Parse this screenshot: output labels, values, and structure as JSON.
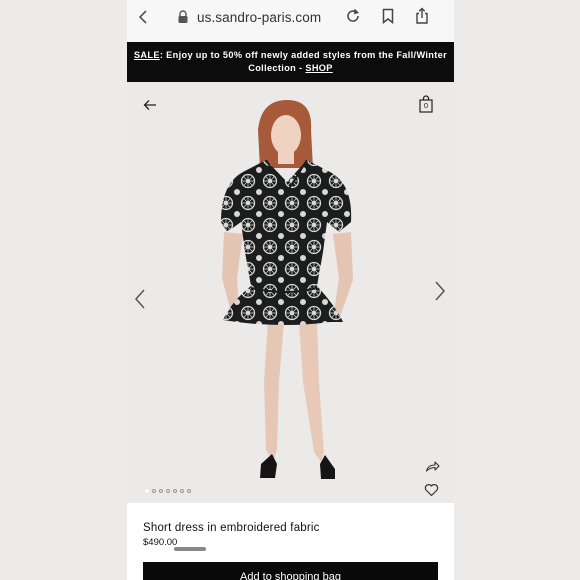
{
  "browser": {
    "url": "us.sandro-paris.com"
  },
  "promo": {
    "sale_label": "SALE",
    "message": ": Enjoy up to 50% off newly added styles from the Fall/Winter Collection - ",
    "shop_label": "SHOP"
  },
  "gallery": {
    "bag_count": "0",
    "image_count": 7,
    "active_index": 0
  },
  "product": {
    "name": "Short dress in embroidered fabric",
    "price": "$490.00",
    "add_to_bag_label": "Add to shopping bag"
  },
  "icons": [
    "chevron-left-icon",
    "lock-icon",
    "reload-icon",
    "bookmark-icon",
    "share-icon",
    "arrow-left-icon",
    "shopping-bag-icon",
    "chevron-right-icon",
    "forward-share-icon",
    "heart-icon"
  ],
  "colors": {
    "banner_background": "#0c0c0c",
    "image_background": "#ebeae8",
    "button_background": "#0a0a0a"
  }
}
